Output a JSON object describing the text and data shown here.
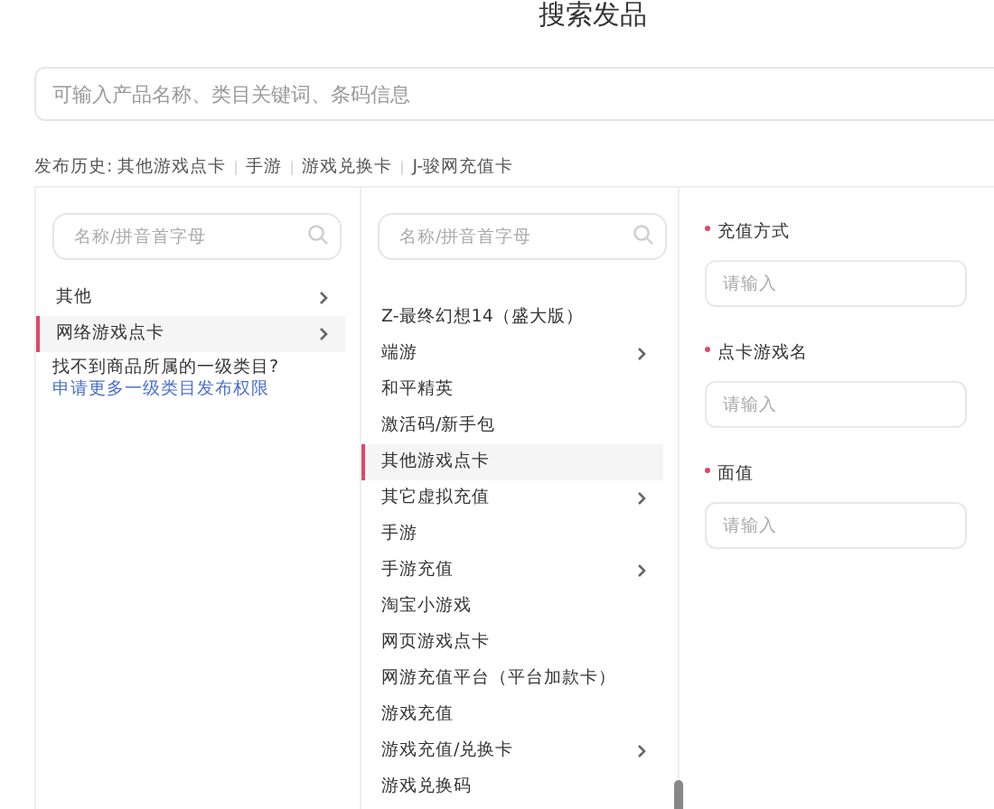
{
  "title": "搜索发品",
  "search": {
    "placeholder": "可输入产品名称、类目关键词、条码信息"
  },
  "history": {
    "label": "发布历史:",
    "items": [
      "其他游戏点卡",
      "手游",
      "游戏兑换卡",
      "J-骏网充值卡"
    ]
  },
  "category_1": {
    "search_placeholder": "名称/拼音首字母",
    "items": [
      {
        "label": "其他",
        "has_children": true,
        "selected": false
      },
      {
        "label": "网络游戏点卡",
        "has_children": true,
        "selected": true
      }
    ],
    "note": "找不到商品所属的一级类目?",
    "note_link": "申请更多一级类目发布权限"
  },
  "category_2": {
    "search_placeholder": "名称/拼音首字母",
    "items": [
      {
        "label": "Z-最终幻想14（盛大版）",
        "has_children": false,
        "selected": false
      },
      {
        "label": "端游",
        "has_children": true,
        "selected": false
      },
      {
        "label": "和平精英",
        "has_children": false,
        "selected": false
      },
      {
        "label": "激活码/新手包",
        "has_children": false,
        "selected": false
      },
      {
        "label": "其他游戏点卡",
        "has_children": false,
        "selected": true
      },
      {
        "label": "其它虚拟充值",
        "has_children": true,
        "selected": false
      },
      {
        "label": "手游",
        "has_children": false,
        "selected": false
      },
      {
        "label": "手游充值",
        "has_children": true,
        "selected": false
      },
      {
        "label": "淘宝小游戏",
        "has_children": false,
        "selected": false
      },
      {
        "label": "网页游戏点卡",
        "has_children": false,
        "selected": false
      },
      {
        "label": "网游充值平台（平台加款卡）",
        "has_children": false,
        "selected": false
      },
      {
        "label": "游戏充值",
        "has_children": false,
        "selected": false
      },
      {
        "label": "游戏充值/兑换卡",
        "has_children": true,
        "selected": false
      },
      {
        "label": "游戏兑换码",
        "has_children": false,
        "selected": false
      }
    ]
  },
  "form": {
    "fields": [
      {
        "label": "充值方式",
        "required": true,
        "placeholder": "请输入"
      },
      {
        "label": "点卡游戏名",
        "required": true,
        "placeholder": "请输入"
      },
      {
        "label": "面值",
        "required": true,
        "placeholder": "请输入"
      }
    ]
  }
}
